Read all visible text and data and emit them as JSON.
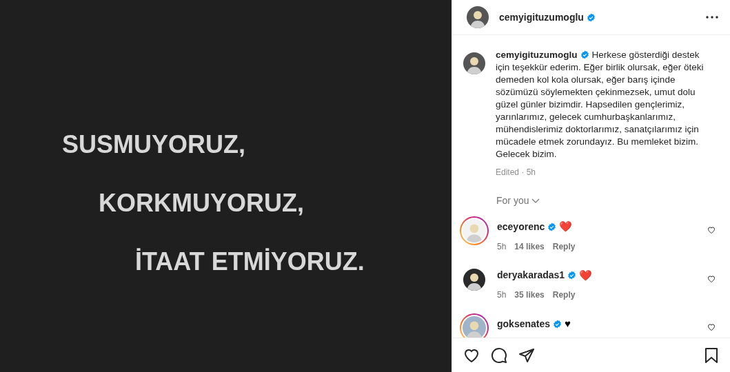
{
  "post_image": {
    "lines": [
      "SUSMUYORUZ,",
      "KORKMUYORUZ,",
      "İTAAT ETMİYORUZ."
    ]
  },
  "header": {
    "username": "cemyigituzumoglu",
    "verified": true
  },
  "caption": {
    "username": "cemyigituzumoglu",
    "verified": true,
    "text": "Herkese gösterdiği destek için teşekkür ederim. Eğer birlik olursak, eğer öteki demeden kol kola olursak, eğer barış içinde sözümüzü söylemekten çekinmezsek, umut dolu güzel günler bizimdir. Hapsedilen gençlerimiz, yarınlarımız, gelecek cumhurbaşkanlarımız, mühendislerimiz doktorlarımız, sanatçılarımız için mücadele etmek zorundayız. Bu memleket bizim. Gelecek bizim.",
    "meta": "Edited · 5h"
  },
  "sort": {
    "label": "For you"
  },
  "comments": [
    {
      "username": "eceyorenc",
      "verified": true,
      "story_ring": true,
      "text": "❤️",
      "time": "5h",
      "likes": "14 likes",
      "reply": "Reply"
    },
    {
      "username": "deryakaradas1",
      "verified": true,
      "story_ring": false,
      "text": "❤️",
      "time": "5h",
      "likes": "35 likes",
      "reply": "Reply"
    },
    {
      "username": "goksenates",
      "verified": true,
      "story_ring": true,
      "text": "♥"
    }
  ]
}
